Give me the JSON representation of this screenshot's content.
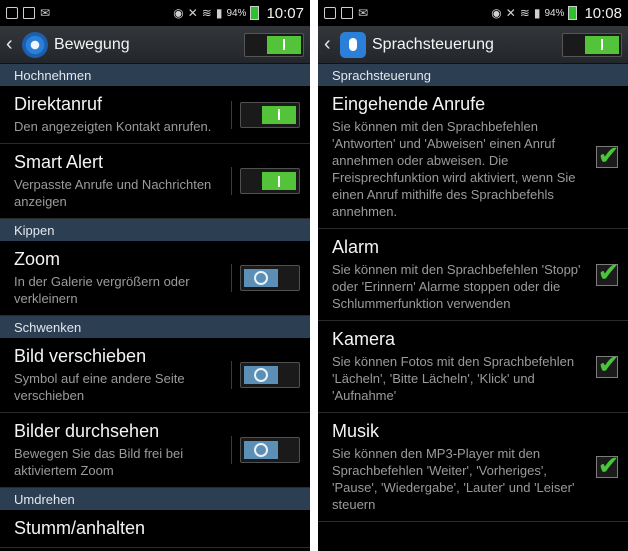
{
  "left": {
    "status": {
      "battery": "94%",
      "time": "10:07"
    },
    "action_bar": {
      "title": "Bewegung",
      "master_toggle": "on"
    },
    "sections": [
      {
        "header": "Hochnehmen",
        "items": [
          {
            "title": "Direktanruf",
            "desc": "Den angezeigten Kontakt anrufen.",
            "state": "on"
          },
          {
            "title": "Smart Alert",
            "desc": "Verpasste Anrufe und Nachrichten anzeigen",
            "state": "on"
          }
        ]
      },
      {
        "header": "Kippen",
        "items": [
          {
            "title": "Zoom",
            "desc": "In der Galerie vergrößern oder verkleinern",
            "state": "off"
          }
        ]
      },
      {
        "header": "Schwenken",
        "items": [
          {
            "title": "Bild verschieben",
            "desc": "Symbol auf eine andere Seite verschieben",
            "state": "off"
          },
          {
            "title": "Bilder durchsehen",
            "desc": "Bewegen Sie das Bild frei bei aktiviertem Zoom",
            "state": "off"
          }
        ]
      },
      {
        "header": "Umdrehen",
        "items": [
          {
            "title": "Stumm/anhalten",
            "desc": "",
            "state": "off"
          }
        ]
      }
    ]
  },
  "right": {
    "status": {
      "battery": "94%",
      "time": "10:08"
    },
    "action_bar": {
      "title": "Sprachsteuerung",
      "master_toggle": "on"
    },
    "section_header": "Sprachsteuerung",
    "items": [
      {
        "title": "Eingehende Anrufe",
        "desc": "Sie können mit den Sprachbefehlen 'Antworten' und 'Abweisen' einen Anruf annehmen oder abweisen. Die Freisprechfunktion wird aktiviert, wenn Sie einen Anruf mithilfe des Sprachbefehls annehmen.",
        "checked": true
      },
      {
        "title": "Alarm",
        "desc": "Sie können mit den Sprachbefehlen 'Stopp' oder 'Erinnern' Alarme stoppen oder die Schlummerfunktion verwenden",
        "checked": true
      },
      {
        "title": "Kamera",
        "desc": "Sie können Fotos mit den Sprachbefehlen 'Lächeln', 'Bitte Lächeln', 'Klick' und 'Aufnahme'",
        "checked": true
      },
      {
        "title": "Musik",
        "desc": "Sie können den MP3-Player mit den Sprachbefehlen 'Weiter', 'Vorheriges', 'Pause', 'Wiedergabe', 'Lauter' und 'Leiser' steuern",
        "checked": true
      }
    ]
  },
  "icons": {
    "status_left": [
      "gallery-notification-icon",
      "image-notification-icon",
      "email-notification-icon"
    ],
    "status_right": [
      "smart-stay-eye-icon",
      "mute-icon",
      "wifi-icon",
      "signal-icon",
      "battery-icon"
    ],
    "check": "✔",
    "back": "‹"
  },
  "colors": {
    "accent_green": "#53c33a",
    "section_header": "#2c3e52",
    "switch_off": "#5b8fb6"
  }
}
